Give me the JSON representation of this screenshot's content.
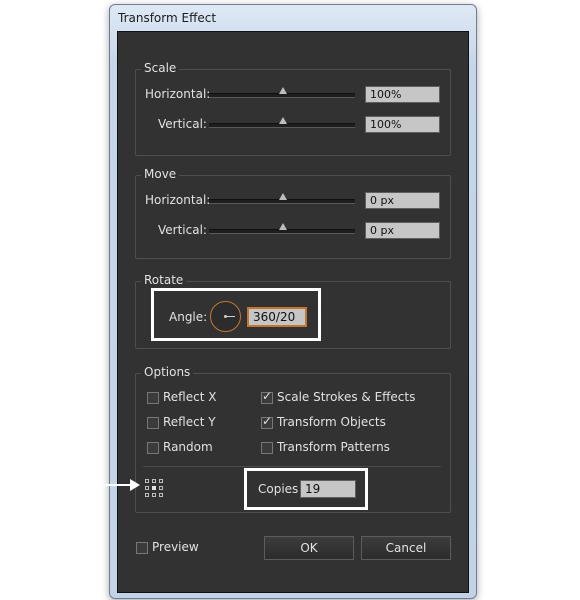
{
  "window": {
    "title": "Transform Effect"
  },
  "scale": {
    "legend": "Scale",
    "horizontal": {
      "label": "Horizontal:",
      "value": "100%",
      "slider": 0.5
    },
    "vertical": {
      "label": "Vertical:",
      "value": "100%",
      "slider": 0.5
    }
  },
  "move": {
    "legend": "Move",
    "horizontal": {
      "label": "Horizontal:",
      "value": "0 px",
      "slider": 0.5
    },
    "vertical": {
      "label": "Vertical:",
      "value": "0 px",
      "slider": 0.5
    }
  },
  "rotate": {
    "legend": "Rotate",
    "angle_label": "Angle:",
    "angle_value": "360/20"
  },
  "options": {
    "legend": "Options",
    "reflect_x": {
      "label": "Reflect X",
      "checked": false
    },
    "reflect_y": {
      "label": "Reflect Y",
      "checked": false
    },
    "random": {
      "label": "Random",
      "checked": false
    },
    "scale_strokes": {
      "label": "Scale Strokes & Effects",
      "checked": true
    },
    "transform_objects": {
      "label": "Transform Objects",
      "checked": true
    },
    "transform_patterns": {
      "label": "Transform Patterns",
      "checked": false
    },
    "copies_label": "Copies",
    "copies_value": "19",
    "check_glyph": "✓"
  },
  "footer": {
    "preview_label": "Preview",
    "preview_checked": false,
    "ok_label": "OK",
    "cancel_label": "Cancel"
  },
  "colors": {
    "background": "#323232",
    "accent": "#c1772f",
    "highlight": "#ffffff"
  },
  "icons": {
    "reference_point": "reference-point-grid-icon",
    "arrow": "arrow-right-icon"
  }
}
